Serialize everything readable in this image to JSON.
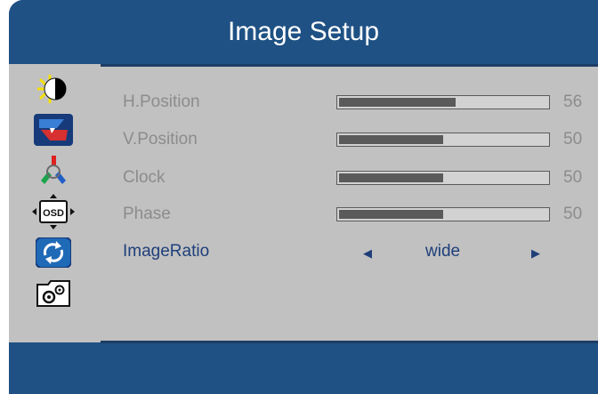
{
  "header": {
    "title": "Image Setup"
  },
  "sidebar": {
    "items": [
      {
        "name": "brightness-contrast-icon"
      },
      {
        "name": "image-setup-icon",
        "selected": true
      },
      {
        "name": "color-setup-icon"
      },
      {
        "name": "osd-setup-icon",
        "text": "OSD"
      },
      {
        "name": "reset-icon"
      },
      {
        "name": "extra-settings-icon"
      }
    ]
  },
  "settings": [
    {
      "label": "H.Position",
      "value": "56",
      "level": 56
    },
    {
      "label": "V.Position",
      "value": "50",
      "level": 50
    },
    {
      "label": "Clock",
      "value": "50",
      "level": 50
    },
    {
      "label": "Phase",
      "value": "50",
      "level": 50
    }
  ],
  "image_ratio": {
    "label": "ImageRatio",
    "value": "wide"
  },
  "colors": {
    "panel_blue": "#1f5184",
    "panel_gray": "#c1c1c1",
    "active_text": "#1f3f7a",
    "inactive_text": "#8c8c8c"
  }
}
